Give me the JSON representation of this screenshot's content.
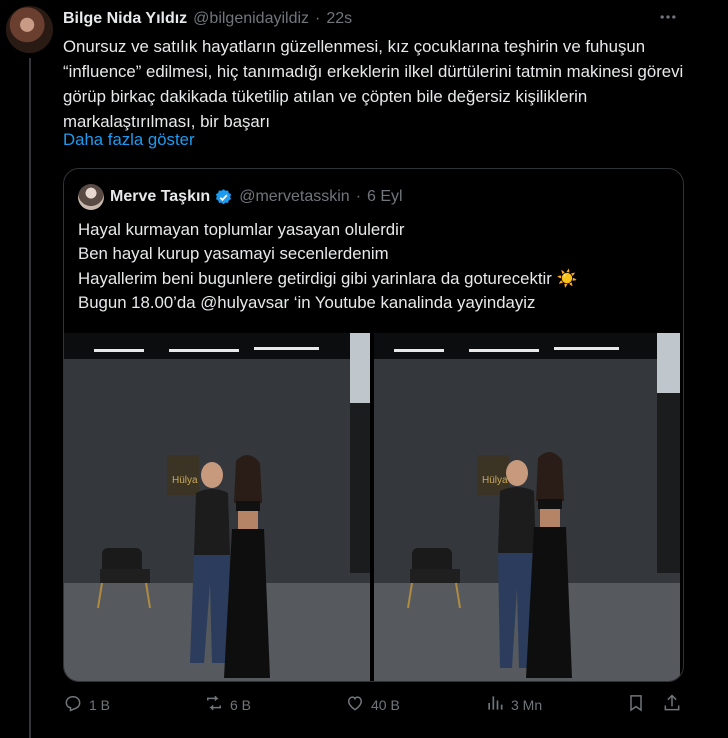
{
  "tweet": {
    "author_name": "Bilge Nida Yıldız",
    "author_handle": "@bilgenidayildiz",
    "separator": "·",
    "time": "22s",
    "text": "Onursuz ve satılık hayatların güzellenmesi, kız çocuklarına teşhirin ve fuhuşun “influence” edilmesi, hiç tanımadığı erkeklerin ilkel dürtülerini tatmin makinesi görevi görüp birkaç dakikada tüketilip atılan ve çöpten bile değersiz kişiliklerin markalaştırılması, bir başarı",
    "show_more": "Daha fazla göster"
  },
  "quoted": {
    "author_name": "Merve Taşkın",
    "author_handle": "@mervetasskin",
    "separator": "·",
    "date": "6 Eyl",
    "lines": [
      "Hayal kurmayan toplumlar yasayan olulerdir",
      "Ben hayal kurup yasamayi secenlerdenim",
      "Hayallerim beni bugunlere getirdigi gibi yarinlara da goturecektir",
      "Bugun 18.00’da @hulyavsar ‘in Youtube kanalinda yayindayiz"
    ],
    "sun_emoji": "☀️",
    "photo_sign_text": "Hülya"
  },
  "actions": {
    "replies": "1 B",
    "reposts": "6 B",
    "likes": "40 B",
    "views": "3 Mn"
  },
  "colors": {
    "background": "#000000",
    "text": "#e7e9ea",
    "muted": "#71767b",
    "link": "#1d9bf0",
    "border": "#2f3336",
    "verified": "#1d9bf0"
  }
}
